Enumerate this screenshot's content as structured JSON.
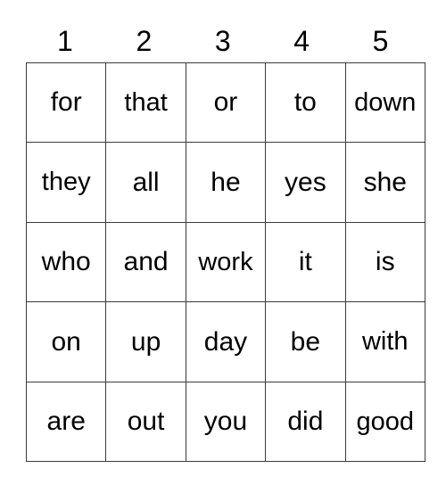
{
  "card": {
    "column_headers": [
      "1",
      "2",
      "3",
      "4",
      "5"
    ],
    "rows": [
      [
        "for",
        "that",
        "or",
        "to",
        "down"
      ],
      [
        "they",
        "all",
        "he",
        "yes",
        "she"
      ],
      [
        "who",
        "and",
        "work",
        "it",
        "is"
      ],
      [
        "on",
        "up",
        "day",
        "be",
        "with"
      ],
      [
        "are",
        "out",
        "you",
        "did",
        "good"
      ]
    ],
    "colors": {
      "background": "#ffffff",
      "text": "#000000",
      "grid_line": "#3b3b3b"
    }
  }
}
